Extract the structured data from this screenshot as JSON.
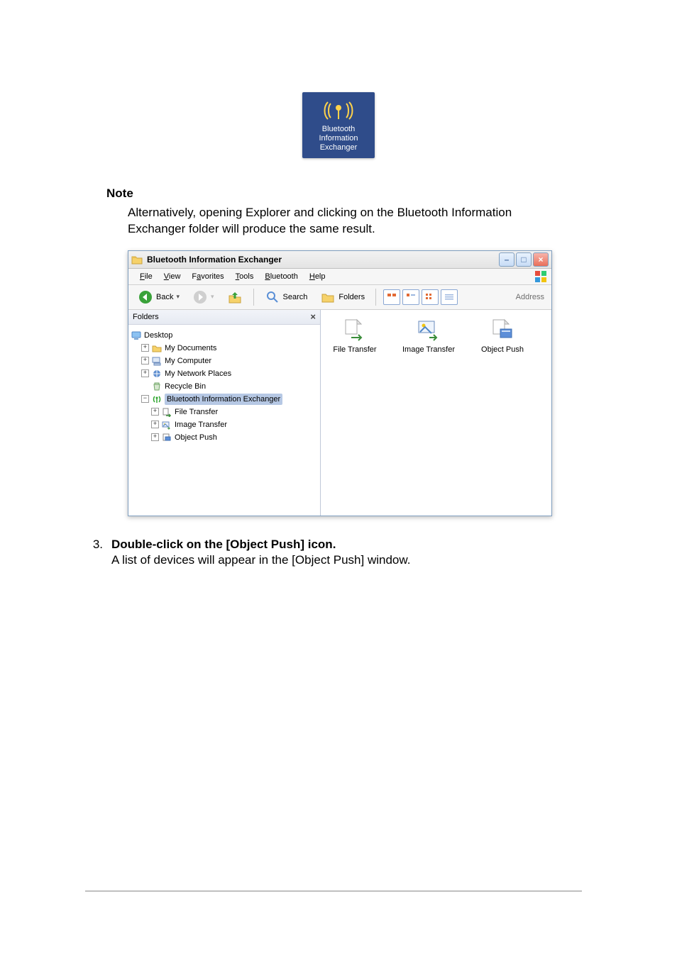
{
  "desktop_icon": {
    "line1": "Bluetooth",
    "line2": "Information",
    "line3": "Exchanger"
  },
  "note": {
    "heading": "Note",
    "text": "Alternatively, opening Explorer and clicking on the Bluetooth Information Exchanger folder will produce the same result."
  },
  "win": {
    "title": "Bluetooth Information Exchanger",
    "menu": {
      "file": "File",
      "view": "View",
      "favorites": "Favorites",
      "tools": "Tools",
      "bluetooth": "Bluetooth",
      "help": "Help"
    },
    "toolbar": {
      "back": "Back",
      "search": "Search",
      "folders": "Folders",
      "address": "Address"
    },
    "folders_pane": {
      "header": "Folders",
      "desktop": "Desktop",
      "my_documents": "My Documents",
      "my_computer": "My Computer",
      "my_network": "My Network Places",
      "recycle_bin": "Recycle Bin",
      "bt_exchanger": "Bluetooth Information Exchanger",
      "file_transfer": "File Transfer",
      "image_transfer": "Image Transfer",
      "object_push": "Object Push"
    },
    "content": {
      "file_transfer": "File Transfer",
      "image_transfer": "Image Transfer",
      "object_push": "Object Push"
    }
  },
  "step3": {
    "num": "3.",
    "title": "Double-click on the [Object Push] icon.",
    "text": "A list of devices will appear in the [Object Push] window."
  }
}
